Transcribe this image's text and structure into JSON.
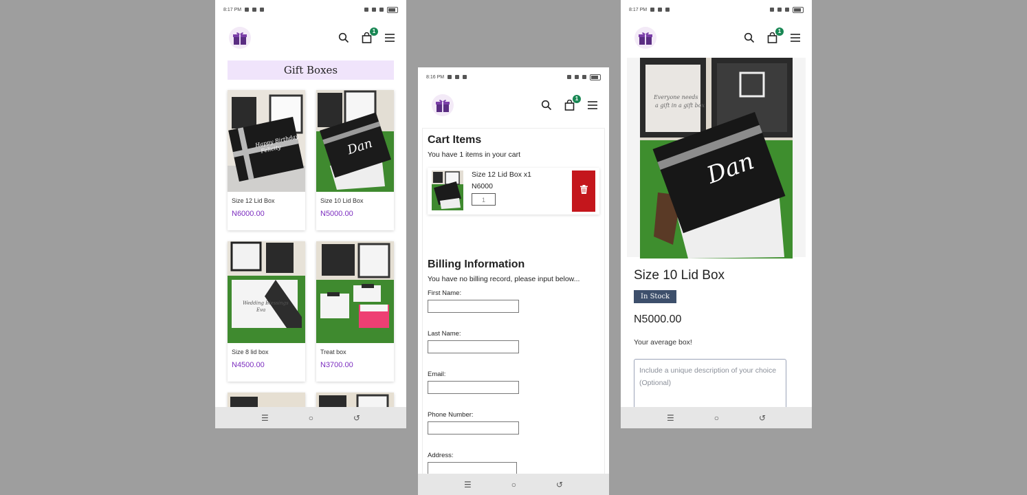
{
  "colors": {
    "accent_purple": "#7b2cbf",
    "badge_green": "#198754",
    "delete_red": "#c4161c",
    "stock_badge": "#3d4f6b",
    "category_bg": "#f0e4fb"
  },
  "left": {
    "status_time": "8:17 PM",
    "cart_count": "1",
    "category_title": "Gift Boxes",
    "products": [
      {
        "name": "Size 12 Lid Box",
        "price": "N6000.00"
      },
      {
        "name": "Size 10 Lid Box",
        "price": "N5000.00"
      },
      {
        "name": "Size 8 lid box",
        "price": "N4500.00"
      },
      {
        "name": "Treat box",
        "price": "N3700.00"
      }
    ]
  },
  "middle": {
    "status_time": "8:16 PM",
    "cart_count": "1",
    "cart_title": "Cart Items",
    "cart_subtitle": "You have 1 items in your cart",
    "cart_item": {
      "name": "Size 12 Lid Box x1",
      "price": "N6000",
      "qty": "1"
    },
    "billing_title": "Billing Information",
    "billing_subtitle": "You have no billing record, please input below...",
    "labels": {
      "first_name": "First Name:",
      "last_name": "Last Name:",
      "email": "Email:",
      "phone": "Phone Number:",
      "address": "Address:"
    }
  },
  "right": {
    "status_time": "8:17 PM",
    "cart_count": "1",
    "product_title": "Size 10 Lid Box",
    "stock": "In Stock",
    "price": "N5000.00",
    "description": "Your average box!",
    "desc_placeholder": "Include a unique description of your choice (Optional)"
  }
}
